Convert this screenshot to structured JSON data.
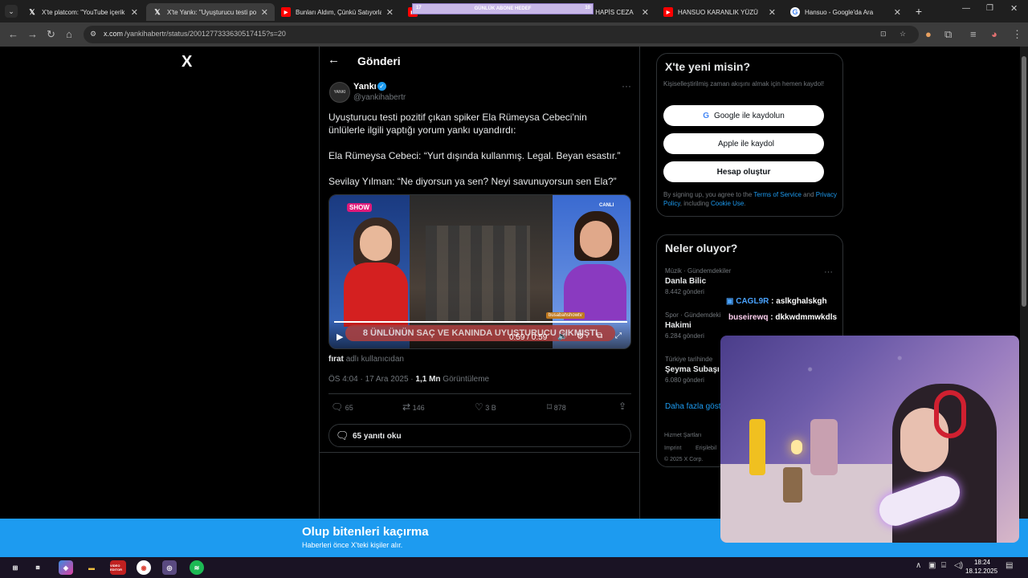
{
  "browser": {
    "tabs": [
      {
        "title": "X'te platcom: \"YouTube içerik ü",
        "icon": "x-icon"
      },
      {
        "title": "X'te Yankı: \"Uyuşturucu testi po",
        "icon": "x-icon",
        "active": true
      },
      {
        "title": "Bunları Aldım, Çünkü Satıyorlar",
        "icon": "youtube-icon"
      },
      {
        "title": "U HAPİS CEZA",
        "icon": "youtube-icon"
      },
      {
        "title": "HANSUO KARANLIK YÜZÜ",
        "icon": "youtube-icon"
      },
      {
        "title": "Hansuo - Google'da Ara",
        "icon": "google-icon"
      }
    ],
    "url_domain": "x.com",
    "url_path": "/yankihabertr/status/2001277333630517415?s=20"
  },
  "overlay_goal": {
    "left": "17",
    "label": "GÜNLÜK ABONE HEDEF",
    "right": "10"
  },
  "x_logo": "X",
  "post_header": {
    "title": "Gönderi"
  },
  "post": {
    "author_name": "Yankı",
    "author_handle": "@yankihabertr",
    "avatar_text": "YANKI",
    "text_1": "Uyuşturucu testi pozitif çıkan spiker Ela Rümeysa Cebeci'nin ünlülerle ilgili yaptığı yorum yankı uyandırdı:",
    "text_2": "Ela Rümeysa Cebeci: “Yurt dışında kullanmış. Legal. Beyan esastır.”",
    "text_3": "Sevilay Yılman: “Ne diyorsun ya sen? Neyi savunuyorsun sen Ela?”",
    "video": {
      "headline": "8 ÜNLÜNÜN SAÇ VE KANINDA UYUŞTURUCU ÇIKMIŞTI",
      "time": "0:59 / 0:59",
      "progress": 1.0,
      "channel": "SHOW",
      "live_badge": "CANLI",
      "web_tag": "busabahshowtv"
    },
    "user_tag_name": "fırat",
    "user_tag_suffix": "adlı kullanıcıdan",
    "timestamp": "ÖS 4:04 · 17 Ara 2025 · ",
    "views": "1,1 Mn",
    "views_label": " Görüntüleme",
    "actions": {
      "replies": "65",
      "reposts": "146",
      "likes": "3 B",
      "bookmarks": "878"
    },
    "read_replies": "65 yanıtı oku"
  },
  "signup": {
    "title": "X'te yeni misin?",
    "subtitle": "Kişiselleştirilmiş zaman akışını almak için hemen kaydol!",
    "google_button": "Google ile kaydolun",
    "apple_button": "Apple ile kaydol",
    "create_button": "Hesap oluştur",
    "legal_1": "By signing up, you agree to the ",
    "terms": "Terms of Service",
    "legal_2": " and ",
    "privacy": "Privacy Policy",
    "legal_3": ", including ",
    "cookie": "Cookie Use",
    "legal_4": "."
  },
  "trends": {
    "title": "Neler oluyor?",
    "items": [
      {
        "category": "Müzik · Gündemdekiler",
        "name": "Danla Bilic",
        "count": "8.442 gönderi"
      },
      {
        "category": "Spor · Gündemdeki",
        "name": "Hakimi",
        "count": "6.284 gönderi"
      },
      {
        "category": "Türkiye tarihinde",
        "name": "Şeyma Subaşı",
        "count": "6.080 gönderi"
      }
    ],
    "show_more": "Daha fazla göst"
  },
  "footer_links": {
    "l1": "Hizmet Şartları",
    "l2": "Imprint",
    "l3": "Erişilebil",
    "copyright": "© 2025 X Corp."
  },
  "stream_chat": [
    {
      "user": "CAGL9R",
      "message": "aslkghalskgh",
      "color": "#4aa3ff"
    },
    {
      "user": "buseirewq",
      "message": "dkkwdmmwkdls",
      "color": "#ffd0f0"
    }
  ],
  "banner": {
    "title": "Olup bitenleri kaçırma",
    "subtitle": "Haberleri önce X'teki kişiler alır."
  },
  "taskbar": {
    "time": "18:24",
    "date": "18.12.2025",
    "video_app_label": "VIDEO EDITOR"
  },
  "colors": {
    "accent": "#1d9bf0",
    "border": "#2f3336",
    "muted": "#71767b"
  }
}
